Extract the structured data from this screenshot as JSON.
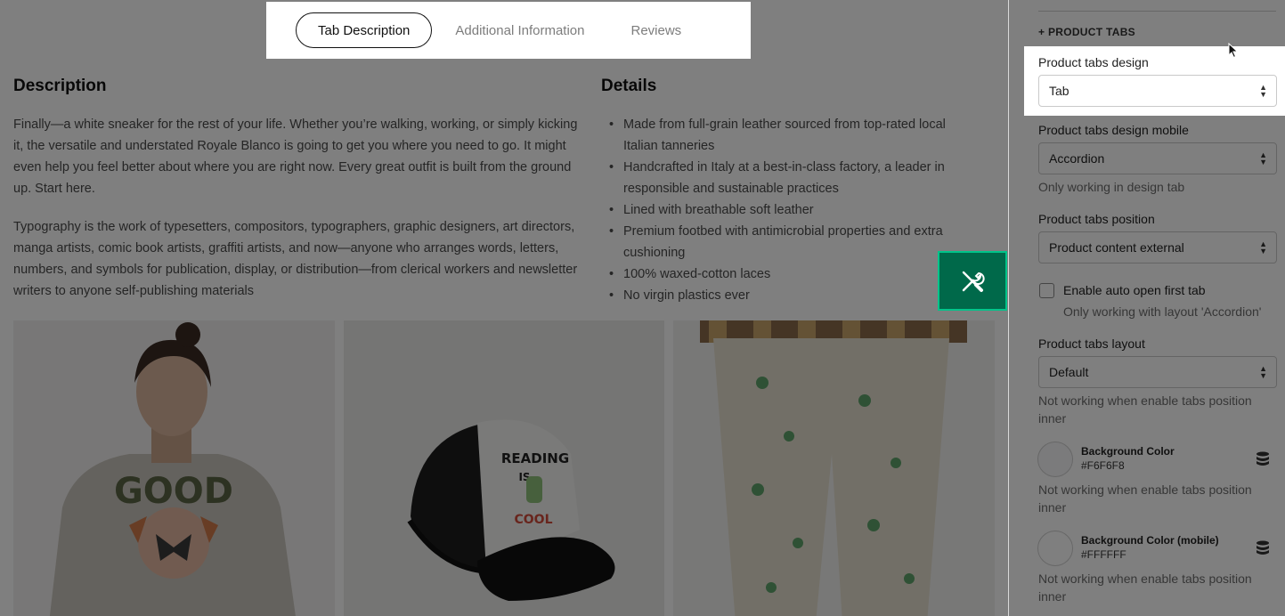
{
  "preview": {
    "tabs": [
      {
        "label": "Tab Description",
        "active": true
      },
      {
        "label": "Additional Information",
        "active": false
      },
      {
        "label": "Reviews",
        "active": false
      }
    ],
    "description": {
      "title": "Description",
      "paragraphs": [
        "Finally—a white sneaker for the rest of your life. Whether you’re walking, working, or simply kicking it, the versatile and understated Royale Blanco is going to get you where you need to go. It might even help you feel better about where you are right now. Every great outfit is built from the ground up. Start here.",
        "Typography is the work of typesetters, compositors, typographers, graphic designers, art directors, manga artists, comic book artists, graffiti artists, and now—anyone who arranges words, letters, numbers, and symbols for publication, display, or distribution—from clerical workers and newsletter writers to anyone self-publishing materials"
      ]
    },
    "details": {
      "title": "Details",
      "items": [
        "Made from full-grain leather sourced from top-rated local Italian tanneries",
        "Handcrafted in Italy at a best-in-class factory, a leader in responsible and sustainable practices",
        "Lined with breathable soft leather",
        "Premium footbed with antimicrobial properties and extra cushioning",
        "100% waxed-cotton laces",
        "No virgin plastics ever"
      ]
    },
    "images": [
      {
        "name": "sweatshirt-model-image"
      },
      {
        "name": "trucker-cap-image",
        "cap_text_top": "READING",
        "cap_text_mid": "IS",
        "cap_text_bottom": "COOL"
      },
      {
        "name": "printed-pants-image"
      }
    ],
    "tool_button_icon": "wrench-screwdriver-icon"
  },
  "panel": {
    "section_header": "+ PRODUCT TABS",
    "fields": {
      "design_label": "Product tabs design",
      "design_value": "Tab",
      "design_mobile_label": "Product tabs design mobile",
      "design_mobile_value": "Accordion",
      "design_mobile_help": "Only working in design tab",
      "position_label": "Product tabs position",
      "position_value": "Product content external",
      "auto_open_label": "Enable auto open first tab",
      "auto_open_checked": false,
      "auto_open_help": "Only working with layout 'Accordion'",
      "layout_label": "Product tabs layout",
      "layout_value": "Default",
      "layout_help": "Not working when enable tabs position inner",
      "bg_color_label": "Background Color",
      "bg_color_value": "#F6F6F8",
      "bg_color_help": "Not working when enable tabs position inner",
      "bg_color_mobile_label": "Background Color (mobile)",
      "bg_color_mobile_value": "#FFFFFF",
      "bg_color_mobile_help": "Not working when enable tabs position inner"
    }
  },
  "colors": {
    "accent_green": "#00694a",
    "accent_green_border": "#00c48a",
    "swatch_1": "#F6F6F8",
    "swatch_2": "#FFFFFF"
  }
}
